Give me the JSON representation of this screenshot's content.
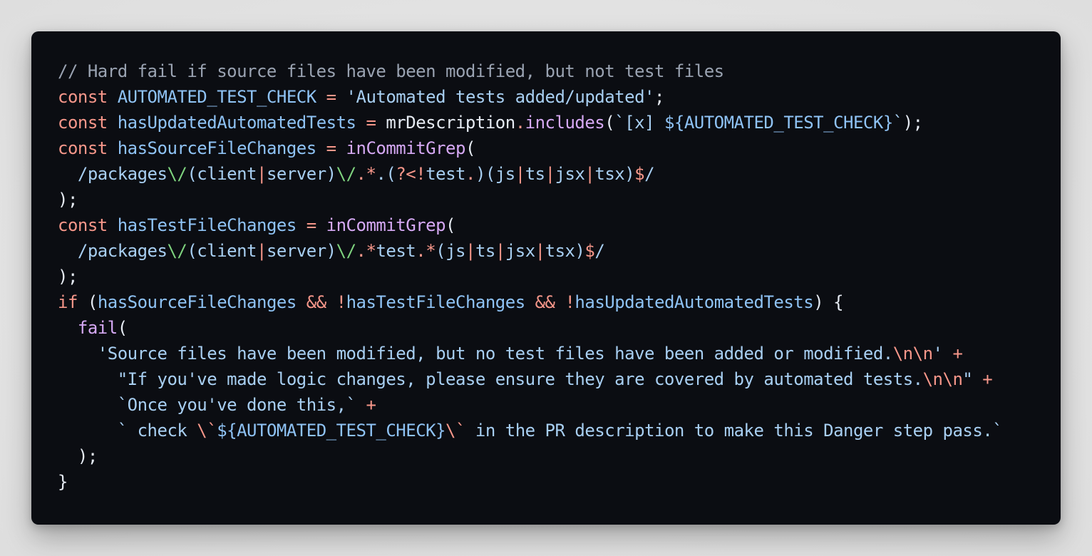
{
  "colors": {
    "background": "#e5e5e5",
    "code_background": "#0b0d12",
    "comment": "#9aa3b2",
    "keyword": "#f7978a",
    "identifier": "#8fc3f5",
    "string": "#a8cff2",
    "function": "#d6a9f5",
    "regex_escape": "#7fd47f",
    "plain": "#e6ebf3"
  },
  "code_lines": [
    [
      {
        "t": "comment",
        "v": "// Hard fail if source files have been modified, but not test files"
      }
    ],
    [
      {
        "t": "keyword",
        "v": "const"
      },
      {
        "t": "plain",
        "v": " "
      },
      {
        "t": "ident",
        "v": "AUTOMATED_TEST_CHECK"
      },
      {
        "t": "plain",
        "v": " "
      },
      {
        "t": "op",
        "v": "="
      },
      {
        "t": "plain",
        "v": " "
      },
      {
        "t": "string",
        "v": "'Automated tests added/updated'"
      },
      {
        "t": "punct",
        "v": ";"
      }
    ],
    [
      {
        "t": "keyword",
        "v": "const"
      },
      {
        "t": "plain",
        "v": " "
      },
      {
        "t": "ident",
        "v": "hasUpdatedAutomatedTests"
      },
      {
        "t": "plain",
        "v": " "
      },
      {
        "t": "op",
        "v": "="
      },
      {
        "t": "plain",
        "v": " mrDescription"
      },
      {
        "t": "op",
        "v": "."
      },
      {
        "t": "func",
        "v": "includes"
      },
      {
        "t": "punct",
        "v": "("
      },
      {
        "t": "string",
        "v": "`[x] "
      },
      {
        "t": "interp",
        "v": "${AUTOMATED_TEST_CHECK}"
      },
      {
        "t": "string",
        "v": "`"
      },
      {
        "t": "punct",
        "v": ");"
      }
    ],
    [
      {
        "t": "keyword",
        "v": "const"
      },
      {
        "t": "plain",
        "v": " "
      },
      {
        "t": "ident",
        "v": "hasSourceFileChanges"
      },
      {
        "t": "plain",
        "v": " "
      },
      {
        "t": "op",
        "v": "="
      },
      {
        "t": "plain",
        "v": " "
      },
      {
        "t": "func",
        "v": "inCommitGrep"
      },
      {
        "t": "punct",
        "v": "("
      }
    ],
    [
      {
        "t": "plain",
        "v": "  "
      },
      {
        "t": "regex",
        "v": "/packages"
      },
      {
        "t": "regex-esc",
        "v": "\\/"
      },
      {
        "t": "regex",
        "v": "(client"
      },
      {
        "t": "regex-op",
        "v": "|"
      },
      {
        "t": "regex",
        "v": "server)"
      },
      {
        "t": "regex-esc",
        "v": "\\/"
      },
      {
        "t": "regex-op",
        "v": "."
      },
      {
        "t": "regex-op",
        "v": "*"
      },
      {
        "t": "regex",
        "v": "."
      },
      {
        "t": "regex",
        "v": "("
      },
      {
        "t": "regex-op",
        "v": "?<!"
      },
      {
        "t": "regex",
        "v": "test"
      },
      {
        "t": "regex-op",
        "v": "."
      },
      {
        "t": "regex",
        "v": ")(js"
      },
      {
        "t": "regex-op",
        "v": "|"
      },
      {
        "t": "regex",
        "v": "ts"
      },
      {
        "t": "regex-op",
        "v": "|"
      },
      {
        "t": "regex",
        "v": "jsx"
      },
      {
        "t": "regex-op",
        "v": "|"
      },
      {
        "t": "regex",
        "v": "tsx)"
      },
      {
        "t": "regex-op",
        "v": "$"
      },
      {
        "t": "regex",
        "v": "/"
      }
    ],
    [
      {
        "t": "punct",
        "v": ");"
      }
    ],
    [
      {
        "t": "keyword",
        "v": "const"
      },
      {
        "t": "plain",
        "v": " "
      },
      {
        "t": "ident",
        "v": "hasTestFileChanges"
      },
      {
        "t": "plain",
        "v": " "
      },
      {
        "t": "op",
        "v": "="
      },
      {
        "t": "plain",
        "v": " "
      },
      {
        "t": "func",
        "v": "inCommitGrep"
      },
      {
        "t": "punct",
        "v": "("
      }
    ],
    [
      {
        "t": "plain",
        "v": "  "
      },
      {
        "t": "regex",
        "v": "/packages"
      },
      {
        "t": "regex-esc",
        "v": "\\/"
      },
      {
        "t": "regex",
        "v": "(client"
      },
      {
        "t": "regex-op",
        "v": "|"
      },
      {
        "t": "regex",
        "v": "server)"
      },
      {
        "t": "regex-esc",
        "v": "\\/"
      },
      {
        "t": "regex-op",
        "v": "."
      },
      {
        "t": "regex-op",
        "v": "*"
      },
      {
        "t": "regex",
        "v": "test"
      },
      {
        "t": "regex-op",
        "v": "."
      },
      {
        "t": "regex-op",
        "v": "*"
      },
      {
        "t": "regex",
        "v": "(js"
      },
      {
        "t": "regex-op",
        "v": "|"
      },
      {
        "t": "regex",
        "v": "ts"
      },
      {
        "t": "regex-op",
        "v": "|"
      },
      {
        "t": "regex",
        "v": "jsx"
      },
      {
        "t": "regex-op",
        "v": "|"
      },
      {
        "t": "regex",
        "v": "tsx)"
      },
      {
        "t": "regex-op",
        "v": "$"
      },
      {
        "t": "regex",
        "v": "/"
      }
    ],
    [
      {
        "t": "punct",
        "v": ");"
      }
    ],
    [
      {
        "t": "keyword",
        "v": "if"
      },
      {
        "t": "plain",
        "v": " ("
      },
      {
        "t": "ident",
        "v": "hasSourceFileChanges"
      },
      {
        "t": "plain",
        "v": " "
      },
      {
        "t": "op",
        "v": "&&"
      },
      {
        "t": "plain",
        "v": " "
      },
      {
        "t": "op",
        "v": "!"
      },
      {
        "t": "ident",
        "v": "hasTestFileChanges"
      },
      {
        "t": "plain",
        "v": " "
      },
      {
        "t": "op",
        "v": "&&"
      },
      {
        "t": "plain",
        "v": " "
      },
      {
        "t": "op",
        "v": "!"
      },
      {
        "t": "ident",
        "v": "hasUpdatedAutomatedTests"
      },
      {
        "t": "plain",
        "v": ") {"
      }
    ],
    [
      {
        "t": "plain",
        "v": "  "
      },
      {
        "t": "func",
        "v": "fail"
      },
      {
        "t": "punct",
        "v": "("
      }
    ],
    [
      {
        "t": "plain",
        "v": "    "
      },
      {
        "t": "string",
        "v": "'Source files have been modified, but no test files have been added or modified."
      },
      {
        "t": "escape",
        "v": "\\n\\n"
      },
      {
        "t": "string",
        "v": "'"
      },
      {
        "t": "plain",
        "v": " "
      },
      {
        "t": "op",
        "v": "+"
      }
    ],
    [
      {
        "t": "plain",
        "v": "      "
      },
      {
        "t": "string",
        "v": "\"If you've made logic changes, please ensure they are covered by automated tests."
      },
      {
        "t": "escape",
        "v": "\\n\\n"
      },
      {
        "t": "string",
        "v": "\""
      },
      {
        "t": "plain",
        "v": " "
      },
      {
        "t": "op",
        "v": "+"
      }
    ],
    [
      {
        "t": "plain",
        "v": "      "
      },
      {
        "t": "string",
        "v": "`Once you've done this,`"
      },
      {
        "t": "plain",
        "v": " "
      },
      {
        "t": "op",
        "v": "+"
      }
    ],
    [
      {
        "t": "plain",
        "v": "      "
      },
      {
        "t": "string",
        "v": "` check "
      },
      {
        "t": "escape",
        "v": "\\`"
      },
      {
        "t": "interp",
        "v": "${AUTOMATED_TEST_CHECK}"
      },
      {
        "t": "escape",
        "v": "\\`"
      },
      {
        "t": "string",
        "v": " in the PR description to make this Danger step pass.`"
      }
    ],
    [
      {
        "t": "plain",
        "v": "  "
      },
      {
        "t": "punct",
        "v": ");"
      }
    ],
    [
      {
        "t": "punct",
        "v": "}"
      }
    ]
  ]
}
